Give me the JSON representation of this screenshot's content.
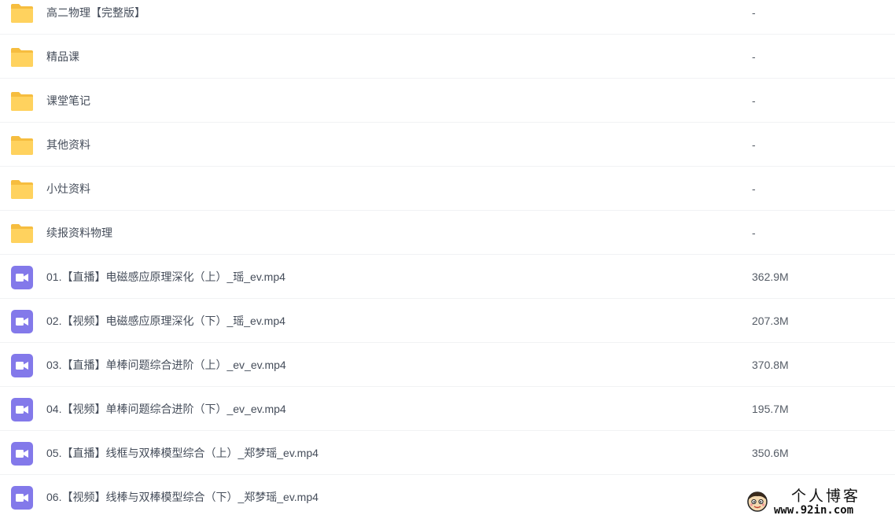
{
  "colors": {
    "folder": "#ffd25e",
    "folder_tab": "#f6bd3f",
    "video": "#8379ea",
    "divider": "#f1f2f4",
    "text": "#454d5a"
  },
  "files": [
    {
      "type": "folder",
      "icon": "folder-icon",
      "name": "高二物理【完整版】",
      "size": "-"
    },
    {
      "type": "folder",
      "icon": "folder-icon",
      "name": "精品课",
      "size": "-"
    },
    {
      "type": "folder",
      "icon": "folder-icon",
      "name": "课堂笔记",
      "size": "-"
    },
    {
      "type": "folder",
      "icon": "folder-icon",
      "name": "其他资料",
      "size": "-"
    },
    {
      "type": "folder",
      "icon": "folder-icon",
      "name": "小灶资料",
      "size": "-"
    },
    {
      "type": "folder",
      "icon": "folder-icon",
      "name": "续报资料物理",
      "size": "-"
    },
    {
      "type": "video",
      "icon": "video-file-icon",
      "name": "01.【直播】电磁感应原理深化（上）_瑶_ev.mp4",
      "size": "362.9M"
    },
    {
      "type": "video",
      "icon": "video-file-icon",
      "name": "02.【视频】电磁感应原理深化（下）_瑶_ev.mp4",
      "size": "207.3M"
    },
    {
      "type": "video",
      "icon": "video-file-icon",
      "name": "03.【直播】单棒问题综合进阶（上）_ev_ev.mp4",
      "size": "370.8M"
    },
    {
      "type": "video",
      "icon": "video-file-icon",
      "name": "04.【视频】单棒问题综合进阶（下）_ev_ev.mp4",
      "size": "195.7M"
    },
    {
      "type": "video",
      "icon": "video-file-icon",
      "name": "05.【直播】线框与双棒模型综合（上）_郑梦瑶_ev.mp4",
      "size": "350.6M"
    },
    {
      "type": "video",
      "icon": "video-file-icon",
      "name": "06.【视频】线棒与双棒模型综合（下）_郑梦瑶_ev.mp4",
      "size": ""
    }
  ],
  "watermark": {
    "title": "个人博客",
    "url": "www.92in.com",
    "icon": "cartoon-face-icon"
  }
}
